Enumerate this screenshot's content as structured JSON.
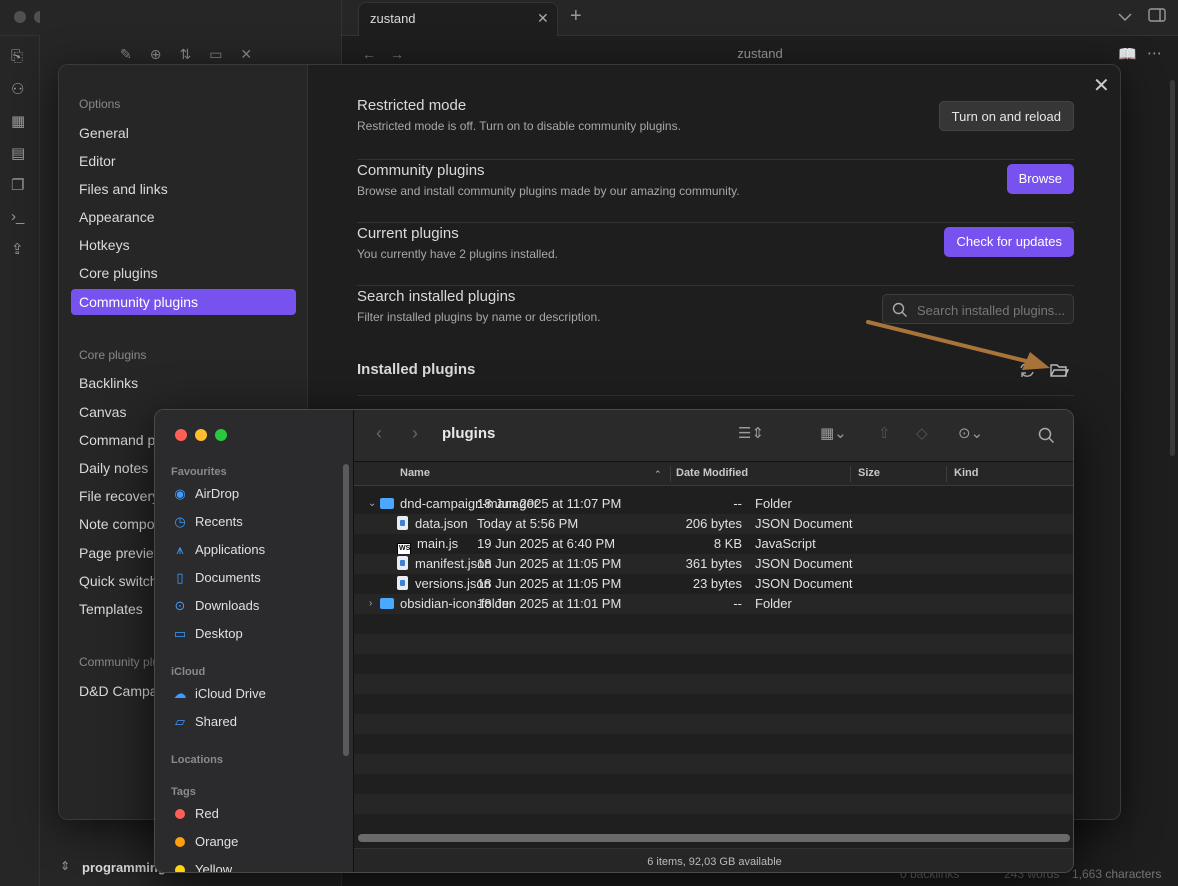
{
  "obsidian": {
    "tab_title": "zustand",
    "note_title": "zustand",
    "vault_name": "programming",
    "status": {
      "backlinks": "0 backlinks",
      "words": "243 words",
      "characters": "1,663 characters"
    }
  },
  "settings": {
    "nav": {
      "options_heading": "Options",
      "options": [
        "General",
        "Editor",
        "Files and links",
        "Appearance",
        "Hotkeys",
        "Core plugins",
        "Community plugins"
      ],
      "active_index": 6,
      "core_heading": "Core plugins",
      "core": [
        "Backlinks",
        "Canvas",
        "Command palette",
        "Daily notes",
        "File recovery",
        "Note composer",
        "Page preview",
        "Quick switcher",
        "Templates"
      ],
      "community_heading": "Community plugins",
      "community": [
        "D&D Campaign Manager"
      ]
    },
    "restricted": {
      "name": "Restricted mode",
      "desc": "Restricted mode is off. Turn on to disable community plugins.",
      "button": "Turn on and reload"
    },
    "community": {
      "name": "Community plugins",
      "desc": "Browse and install community plugins made by our amazing community.",
      "button": "Browse"
    },
    "current": {
      "name": "Current plugins",
      "desc": "You currently have 2 plugins installed.",
      "button": "Check for updates"
    },
    "search": {
      "name": "Search installed plugins",
      "desc": "Filter installed plugins by name or description.",
      "placeholder": "Search installed plugins..."
    },
    "installed_heading": "Installed plugins"
  },
  "finder": {
    "title": "plugins",
    "sidebar": {
      "favourites_heading": "Favourites",
      "favourites": [
        {
          "label": "AirDrop",
          "icon": "airdrop-icon"
        },
        {
          "label": "Recents",
          "icon": "clock-icon"
        },
        {
          "label": "Applications",
          "icon": "applications-icon"
        },
        {
          "label": "Documents",
          "icon": "document-icon"
        },
        {
          "label": "Downloads",
          "icon": "download-icon"
        },
        {
          "label": "Desktop",
          "icon": "desktop-icon"
        }
      ],
      "icloud_heading": "iCloud",
      "icloud": [
        {
          "label": "iCloud Drive",
          "icon": "cloud-icon"
        },
        {
          "label": "Shared",
          "icon": "shared-folder-icon"
        }
      ],
      "locations_heading": "Locations",
      "tags_heading": "Tags",
      "tags": [
        {
          "label": "Red",
          "color": "#ff5f57"
        },
        {
          "label": "Orange",
          "color": "#ff9f0a"
        },
        {
          "label": "Yellow",
          "color": "#ffd60a"
        }
      ]
    },
    "columns": {
      "name": "Name",
      "date": "Date Modified",
      "size": "Size",
      "kind": "Kind"
    },
    "rows": [
      {
        "name": "dnd-campaign-manager",
        "date": "18 Jun 2025 at 11:07 PM",
        "size": "--",
        "kind": "Folder",
        "type": "folder",
        "expanded": true,
        "level": 0
      },
      {
        "name": "data.json",
        "date": "Today at 5:56 PM",
        "size": "206 bytes",
        "kind": "JSON Document",
        "type": "json",
        "level": 1
      },
      {
        "name": "main.js",
        "date": "19 Jun 2025 at 6:40 PM",
        "size": "8 KB",
        "kind": "JavaScript",
        "type": "js",
        "level": 1
      },
      {
        "name": "manifest.json",
        "date": "18 Jun 2025 at 11:05 PM",
        "size": "361 bytes",
        "kind": "JSON Document",
        "type": "json",
        "level": 1
      },
      {
        "name": "versions.json",
        "date": "18 Jun 2025 at 11:05 PM",
        "size": "23 bytes",
        "kind": "JSON Document",
        "type": "json",
        "level": 1
      },
      {
        "name": "obsidian-icon-folder",
        "date": "18 Jun 2025 at 11:01 PM",
        "size": "--",
        "kind": "Folder",
        "type": "folder",
        "expanded": false,
        "level": 0
      }
    ],
    "status": "6 items, 92,03 GB available"
  },
  "colors": {
    "accent": "#7852ee",
    "annotation_arrow": "#a8743a"
  }
}
